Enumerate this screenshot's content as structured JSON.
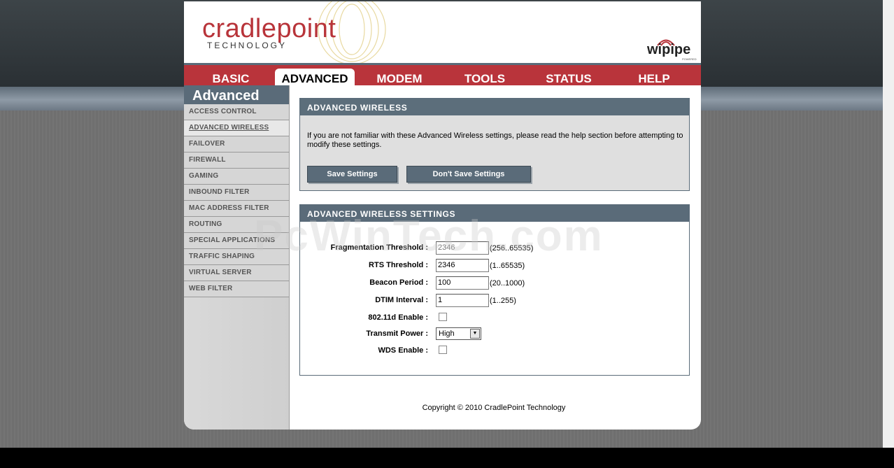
{
  "header": {
    "brand": "cradlepoint",
    "brand_sub": "TECHNOLOGY",
    "partner_logo": "wipipe",
    "partner_sub": "POWERED"
  },
  "nav": {
    "tabs": [
      {
        "label": "BASIC"
      },
      {
        "label": "ADVANCED",
        "active": true
      },
      {
        "label": "MODEM"
      },
      {
        "label": "TOOLS"
      },
      {
        "label": "STATUS"
      },
      {
        "label": "HELP"
      }
    ]
  },
  "sidebar": {
    "title": "Advanced",
    "items": [
      {
        "label": "ACCESS CONTROL"
      },
      {
        "label": "ADVANCED WIRELESS",
        "active": true
      },
      {
        "label": "FAILOVER"
      },
      {
        "label": "FIREWALL"
      },
      {
        "label": "GAMING"
      },
      {
        "label": "INBOUND FILTER"
      },
      {
        "label": "MAC ADDRESS FILTER"
      },
      {
        "label": "ROUTING"
      },
      {
        "label": "SPECIAL APPLICATIONS"
      },
      {
        "label": "TRAFFIC SHAPING"
      },
      {
        "label": "VIRTUAL SERVER"
      },
      {
        "label": "WEB FILTER"
      }
    ]
  },
  "intro_box": {
    "title": "ADVANCED WIRELESS",
    "text": "If you are not familiar with these Advanced Wireless settings, please read the help section before attempting to modify these settings.",
    "save_label": "Save Settings",
    "dont_save_label": "Don't Save Settings"
  },
  "settings_box": {
    "title": "ADVANCED WIRELESS SETTINGS",
    "fragmentation": {
      "label": "Fragmentation Threshold :",
      "value": "2346",
      "range": "(256..65535)"
    },
    "rts": {
      "label": "RTS Threshold :",
      "value": "2346",
      "range": "(1..65535)"
    },
    "beacon": {
      "label": "Beacon Period :",
      "value": "100",
      "range": "(20..1000)"
    },
    "dtim": {
      "label": "DTIM Interval :",
      "value": "1",
      "range": "(1..255)"
    },
    "dot11d": {
      "label": "802.11d Enable :",
      "checked": false
    },
    "transmit_power": {
      "label": "Transmit Power :",
      "value": "High"
    },
    "wds": {
      "label": "WDS Enable :",
      "checked": false
    }
  },
  "watermark": "PcWinTech.com",
  "footer": {
    "copyright": "Copyright © 2010 CradlePoint Technology"
  },
  "colors": {
    "brand_red": "#b9343b",
    "header_slate": "#5a6b79"
  }
}
